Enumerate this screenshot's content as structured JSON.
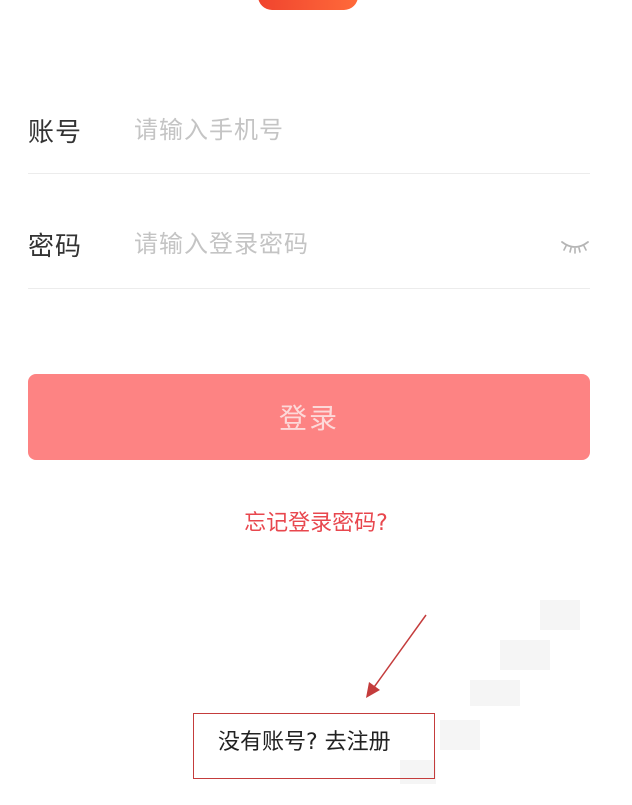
{
  "form": {
    "account": {
      "label": "账号",
      "placeholder": "请输入手机号",
      "value": ""
    },
    "password": {
      "label": "密码",
      "placeholder": "请输入登录密码",
      "value": "",
      "visibility_icon": "eye-closed-icon"
    }
  },
  "login_button": {
    "label": "登录",
    "color": "#fd8383"
  },
  "forgot_password": {
    "label": "忘记登录密码?",
    "color": "#e8474e"
  },
  "register": {
    "label": "没有账号? 去注册"
  },
  "annotation": {
    "color": "#c43c3c",
    "arrow_icon": "arrow-icon"
  },
  "brand": {
    "color": "#f0442e"
  }
}
